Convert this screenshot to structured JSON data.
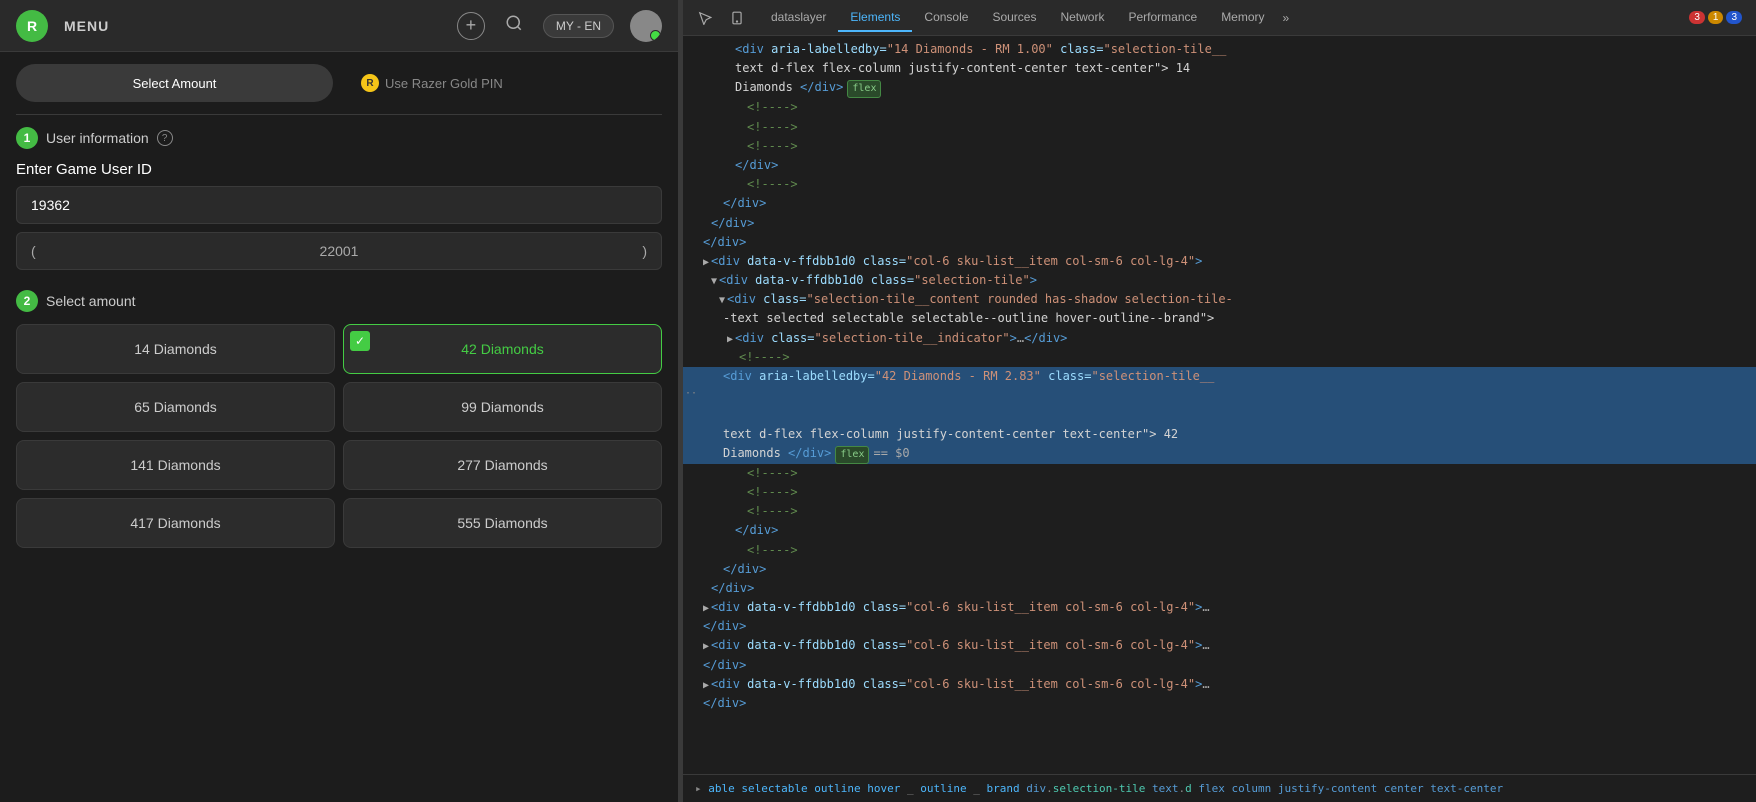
{
  "app": {
    "logo_text": "R",
    "menu_label": "MENU",
    "lang_label": "MY - EN"
  },
  "tabs": {
    "select_amount_label": "Select Amount",
    "razer_gold_pin_label": "Use Razer Gold PIN",
    "razer_icon_char": "R"
  },
  "section1": {
    "step": "1",
    "title": "User information",
    "field_label": "Enter Game User ID",
    "input_value": "19362",
    "paren_left": "(",
    "paren_value": "22001",
    "paren_right": ")"
  },
  "section2": {
    "step": "2",
    "title": "Select amount",
    "items": [
      {
        "label": "14 Diamonds",
        "selected": false
      },
      {
        "label": "42 Diamonds",
        "selected": true
      },
      {
        "label": "65 Diamonds",
        "selected": false
      },
      {
        "label": "99 Diamonds",
        "selected": false
      },
      {
        "label": "141 Diamonds",
        "selected": false
      },
      {
        "label": "277 Diamonds",
        "selected": false
      },
      {
        "label": "417 Diamonds",
        "selected": false
      },
      {
        "label": "555 Diamonds",
        "selected": false
      }
    ]
  },
  "devtools": {
    "tabs": [
      {
        "label": "dataslayer",
        "active": false
      },
      {
        "label": "Elements",
        "active": true
      },
      {
        "label": "Console",
        "active": false
      },
      {
        "label": "Sources",
        "active": false
      },
      {
        "label": "Network",
        "active": false
      },
      {
        "label": "Performance",
        "active": false
      },
      {
        "label": "Memory",
        "active": false
      }
    ],
    "badges": {
      "red": "3",
      "yellow": "1",
      "blue": "3"
    },
    "bottom_bar": "▸ able selectable outline hover outline brand   div.selection-tile   text.d flex column justify-content center text-center"
  }
}
